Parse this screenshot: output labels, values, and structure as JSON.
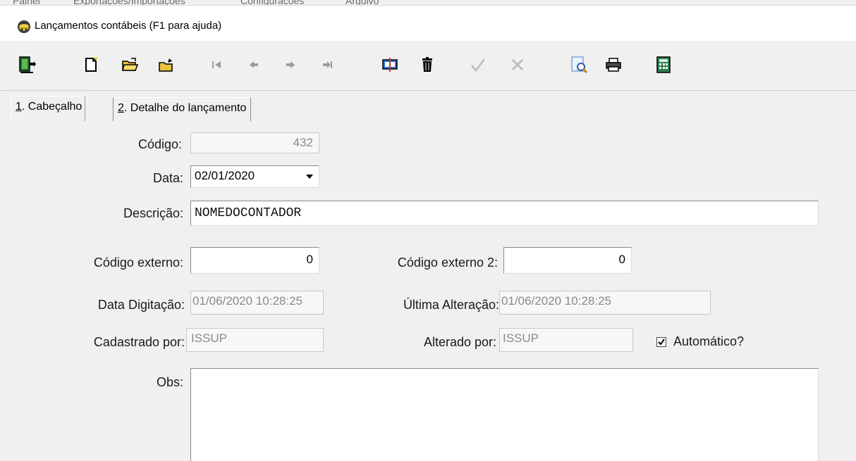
{
  "menubar": {
    "items": [
      "Painel",
      "Exportações/Importações",
      "Configurações",
      "Arquivo"
    ]
  },
  "window": {
    "title": "Lançamentos contábeis (F1 para ajuda)"
  },
  "toolbar": {
    "buttons": [
      {
        "name": "exit",
        "icon": "exit-door-icon",
        "enabled": true
      },
      {
        "name": "new",
        "icon": "new-document-icon",
        "enabled": true
      },
      {
        "name": "open",
        "icon": "open-folder-icon",
        "enabled": true
      },
      {
        "name": "edit",
        "icon": "edit-folder-icon",
        "enabled": true
      },
      {
        "name": "first",
        "icon": "first-record-icon",
        "enabled": false
      },
      {
        "name": "prior",
        "icon": "prior-record-icon",
        "enabled": false
      },
      {
        "name": "next",
        "icon": "next-record-icon",
        "enabled": false
      },
      {
        "name": "last",
        "icon": "last-record-icon",
        "enabled": false
      },
      {
        "name": "replace",
        "icon": "find-replace-icon",
        "enabled": true
      },
      {
        "name": "delete",
        "icon": "trash-icon",
        "enabled": true
      },
      {
        "name": "post",
        "icon": "checkmark-icon",
        "enabled": false
      },
      {
        "name": "cancel",
        "icon": "cancel-x-icon",
        "enabled": false
      },
      {
        "name": "search",
        "icon": "search-magnifier-icon",
        "enabled": true
      },
      {
        "name": "print",
        "icon": "printer-icon",
        "enabled": true
      },
      {
        "name": "calculator",
        "icon": "calculator-icon",
        "enabled": true
      }
    ]
  },
  "tabs": [
    {
      "hotkey": "1",
      "label": ". Cabeçalho",
      "active": true
    },
    {
      "hotkey": "2",
      "label": ". Detalhe do lançamento",
      "active": false
    }
  ],
  "form": {
    "codigo": {
      "label": "Código:",
      "value": "432"
    },
    "data": {
      "label": "Data:",
      "value": "02/01/2020"
    },
    "descricao": {
      "label": "Descrição:",
      "value": "NOMEDOCONTADOR"
    },
    "codigo_externo": {
      "label": "Código externo:",
      "value": "0"
    },
    "codigo_externo_2": {
      "label": "Código externo 2:",
      "value": "0"
    },
    "data_digitacao": {
      "label": "Data Digitação:",
      "value": "01/06/2020 10:28:25"
    },
    "ultima_alteracao": {
      "label": "Última Alteração:",
      "value": "01/06/2020 10:28:25"
    },
    "cadastrado_por": {
      "label": "Cadastrado por:",
      "value": "ISSUP"
    },
    "alterado_por": {
      "label": "Alterado por:",
      "value": "ISSUP"
    },
    "automatico": {
      "label": "Automático?",
      "checked": true
    },
    "obs": {
      "label": "Obs:",
      "value": ""
    }
  }
}
